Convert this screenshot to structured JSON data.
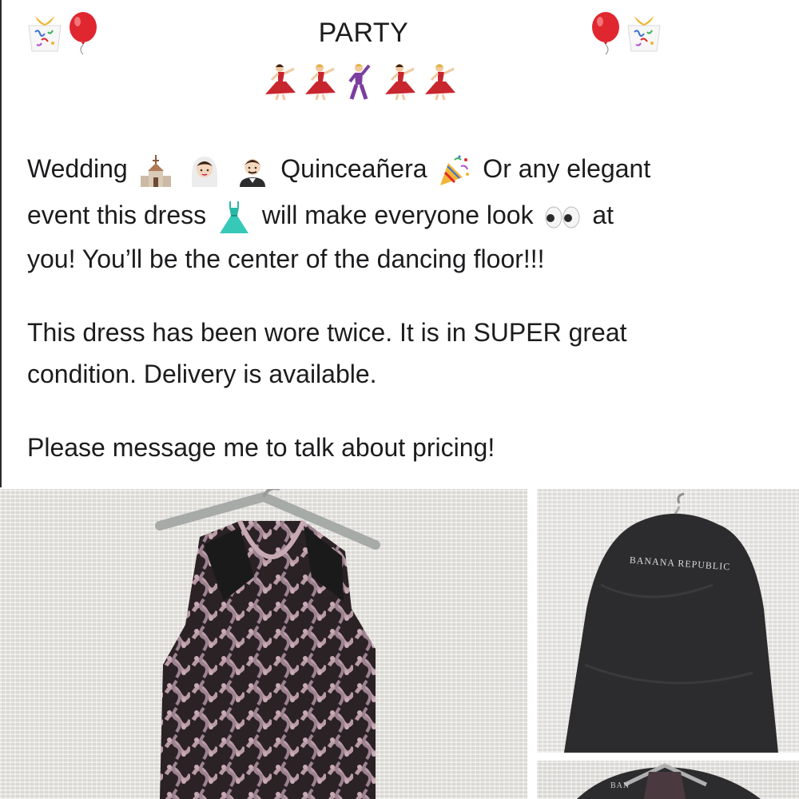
{
  "post": {
    "title": "PARTY",
    "description": {
      "line1_a": "Wedding",
      "line1_b": "Quinceañera",
      "line1_c": "Or any elegant",
      "line2_a": "event this dress",
      "line2_b": "will make everyone look",
      "line2_c": "at",
      "line3": "you! You’ll be the center of the dancing floor!!!",
      "para2_line1": "This dress has been wore twice. It is in SUPER great",
      "para2_line2": "condition. Delivery is available.",
      "para3": "Please message me to talk about pricing!"
    }
  },
  "photos": {
    "bag_brand": "BANANA REPUBLIC",
    "thumb_brand": "BAN"
  },
  "icons": [
    "confetti-gift-icon",
    "red-balloon-icon",
    "dancer-woman-icon",
    "dancer-man-icon",
    "church-icon",
    "bride-icon",
    "groom-icon",
    "party-popper-icon",
    "dress-icon",
    "eyes-icon"
  ],
  "colors": {
    "balloon": "#e0262f",
    "dancer_dress": "#c8262e",
    "man_suit": "#7a3fa0",
    "dress_teal": "#2bb8a8",
    "garment_bag": "#2c2c2e"
  }
}
